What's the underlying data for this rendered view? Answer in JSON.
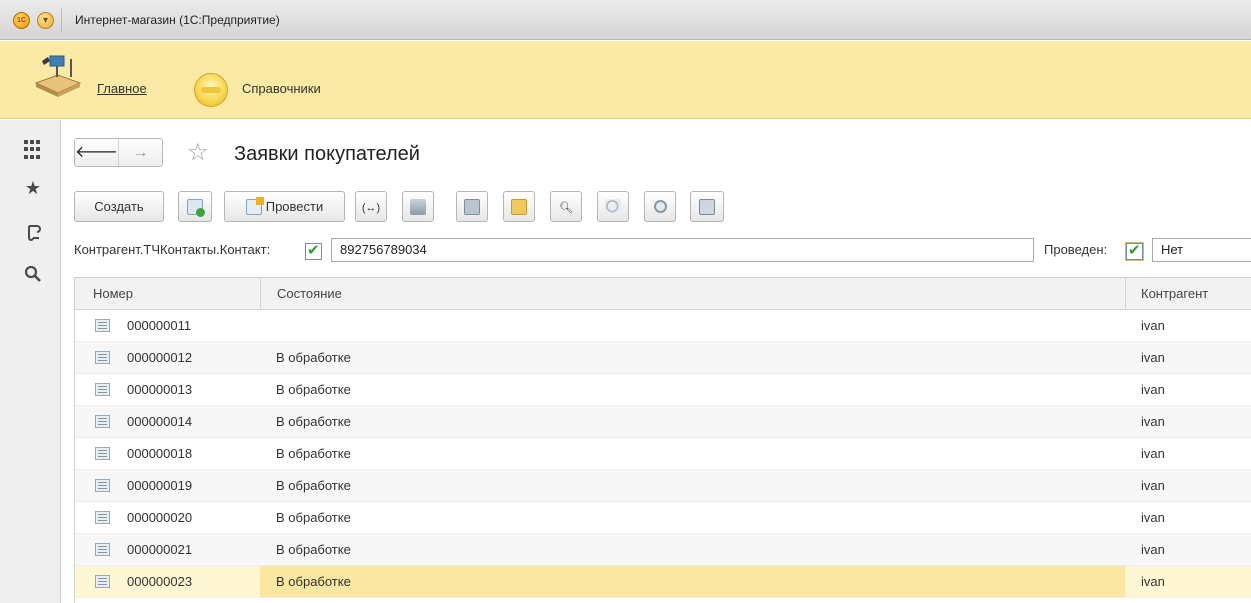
{
  "window": {
    "title": "Интернет-магазин (1С:Предприятие)"
  },
  "sections": {
    "main": "Главное",
    "refs": "Справочники"
  },
  "form": {
    "title": "Заявки покупателей",
    "create_label": "Создать",
    "post_label": "Провести"
  },
  "filter": {
    "contact_label": "Контрагент.ТЧКонтакты.Контакт:",
    "contact_value": "892756789034",
    "posted_label": "Проведен:",
    "posted_value": "Нет"
  },
  "table": {
    "columns": [
      "Номер",
      "Состояние",
      "Контрагент"
    ],
    "rows": [
      {
        "number": "000000011",
        "state": "",
        "counterparty": "ivan"
      },
      {
        "number": "000000012",
        "state": "В обработке",
        "counterparty": "ivan"
      },
      {
        "number": "000000013",
        "state": "В обработке",
        "counterparty": "ivan"
      },
      {
        "number": "000000014",
        "state": "В обработке",
        "counterparty": "ivan"
      },
      {
        "number": "000000018",
        "state": "В обработке",
        "counterparty": "ivan"
      },
      {
        "number": "000000019",
        "state": "В обработке",
        "counterparty": "ivan"
      },
      {
        "number": "000000020",
        "state": "В обработке",
        "counterparty": "ivan"
      },
      {
        "number": "000000021",
        "state": "В обработке",
        "counterparty": "ivan"
      },
      {
        "number": "000000023",
        "state": "В обработке",
        "counterparty": "ivan"
      }
    ],
    "selected_row_index": 8
  },
  "icons": {
    "app_logo": "1c-logo-icon",
    "main_menu": "main-menu-icon",
    "functions_menu": "apps-grid-icon",
    "favorites": "star-icon",
    "history": "history-icon",
    "search": "search-icon"
  },
  "colors": {
    "sections_bg": "#fbeaa5",
    "selected_row": "#fff7d4",
    "check_green": "#2f9e2f"
  }
}
